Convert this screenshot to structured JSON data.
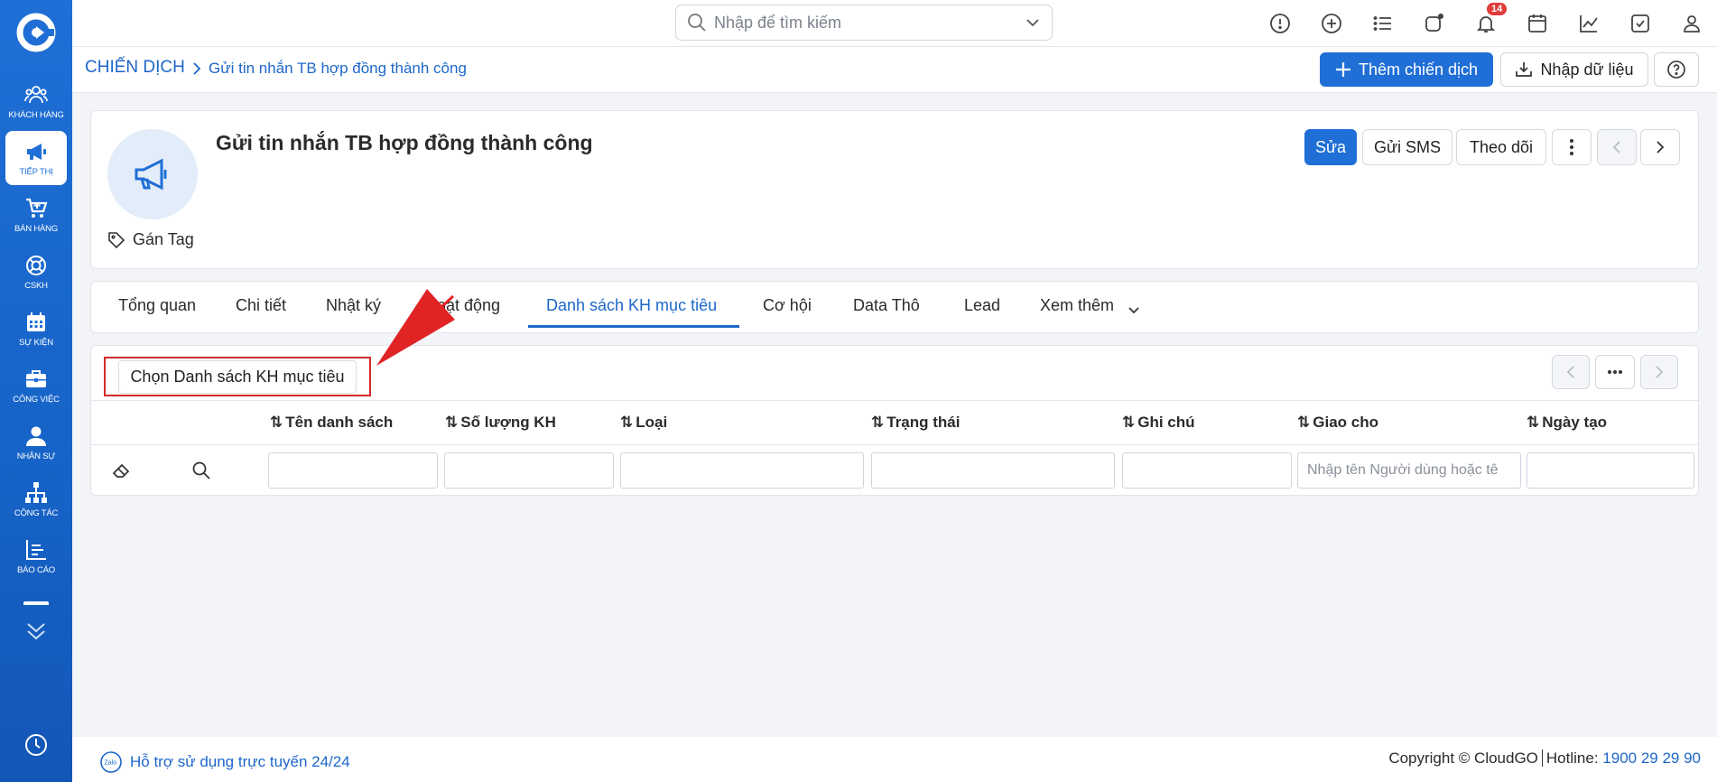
{
  "sidebar": {
    "items": [
      {
        "label": "KHÁCH HÀNG",
        "icon": "users-icon"
      },
      {
        "label": "TIẾP THỊ",
        "icon": "megaphone-icon",
        "active": true
      },
      {
        "label": "BÁN HÀNG",
        "icon": "cart-icon"
      },
      {
        "label": "CSKH",
        "icon": "lifebuoy-icon"
      },
      {
        "label": "SỰ KIỆN",
        "icon": "calendar-icon"
      },
      {
        "label": "CÔNG VIỆC",
        "icon": "briefcase-icon"
      },
      {
        "label": "NHÂN SỰ",
        "icon": "person-icon"
      },
      {
        "label": "CỘNG TÁC",
        "icon": "org-chart-icon"
      },
      {
        "label": "BÁO CÁO",
        "icon": "report-icon"
      }
    ]
  },
  "topbar": {
    "search_placeholder": "Nhập để tìm kiếm",
    "notification_count": "14"
  },
  "breadcrumb": {
    "root": "CHIẾN DỊCH",
    "current": "Gửi tin nhắn TB hợp đồng thành công"
  },
  "actions": {
    "add_campaign": "Thêm chiến dịch",
    "import_data": "Nhập dữ liệu"
  },
  "record": {
    "title": "Gửi tin nhắn TB hợp đồng thành công",
    "tag_label": "Gán Tag",
    "edit": "Sửa",
    "send_sms": "Gửi SMS",
    "follow": "Theo dõi"
  },
  "tabs": [
    {
      "label": "Tổng quan"
    },
    {
      "label": "Chi tiết"
    },
    {
      "label": "Nhật ký"
    },
    {
      "label": "Hoạt động"
    },
    {
      "label": "Danh sách KH mục tiêu",
      "active": true
    },
    {
      "label": "Cơ hội"
    },
    {
      "label": "Data Thô"
    },
    {
      "label": "Lead"
    },
    {
      "label": "Xem thêm"
    }
  ],
  "list": {
    "select_button": "Chọn Danh sách KH mục tiêu",
    "columns": [
      "Tên danh sách",
      "Số lượng KH",
      "Loại",
      "Trạng thái",
      "Ghi chú",
      "Giao cho",
      "Ngày tạo"
    ],
    "assignee_placeholder": "Nhập tên Người dùng hoặc tê"
  },
  "footer": {
    "support": "Hỗ trợ sử dụng trực tuyến 24/24",
    "copyright": "Copyright © CloudGO",
    "hotline_label": "Hotline:",
    "hotline": "1900 29 29 90"
  },
  "colors": {
    "brand": "#1f6fd6",
    "highlight": "#d42a2a"
  }
}
